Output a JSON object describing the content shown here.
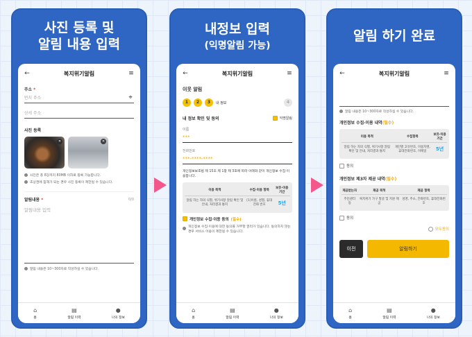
{
  "panel1": {
    "heading_line1": "사진 등록 및",
    "heading_line2": "알림 내용 입력",
    "app_title": "복지위기알림",
    "address_label": "주소",
    "address_placeholder": "번지 주소",
    "detail_placeholder": "상세 주소",
    "photo_label": "사진 등록",
    "photo_note1": "사진은 총 8장까지 80MB 이하로 등록 가능합니다.",
    "photo_note2": "초상권에 침해가 되는 경우 사진 등록이 제한될 수 있습니다.",
    "content_label": "알림내용",
    "content_counter": "0/0",
    "content_placeholder": "알림내용 입력",
    "content_note": "알림 내용은 10~300자로 작성하실 수 있습니다."
  },
  "panel2": {
    "heading_line1": "내정보 입력",
    "heading_line2": "(익명알림 가능)",
    "app_title": "복지위기알림",
    "section_title": "이웃 알림",
    "steps": [
      "1",
      "2",
      "3"
    ],
    "step_label": "내 정보",
    "step_next": "4",
    "info_title": "내 정보 확인 및 동의",
    "anon_label": "익명알림",
    "name_label": "이름",
    "name_value": "***",
    "phone_label": "전화번호",
    "phone_value": "***-****-****",
    "consent_text": "개인정보보호법 제 15조 제 1항 제 3호에 따라 아래와 같이 개인정보 수집·이용합니다.",
    "table_headers": [
      "이용 목적",
      "수집·이용 항목",
      "보유·이용 기간"
    ],
    "table_row": [
      "알림 하는 자의 식별, 위기사항 알림 확인 및 안내, 처리결과 통지",
      "[1]이름, 성별, 휴대전화 번호",
      "5년"
    ],
    "agree_label": "개인정보 수집·이용 동의",
    "agree_required": "(필수)",
    "agree_note": "개인정보 수집·이용에 대한 동의를 거부할 권리가 있습니다. 동의하지 않는 경우 서비스 이용이 제한될 수 있습니다."
  },
  "panel3": {
    "heading_line1": "알림 하기 완료",
    "app_title": "복지위기알림",
    "top_note": "알림 내용은 10~300자로 작성하실 수 있습니다.",
    "collect_title": "개인정보 수집·이용 내역",
    "required": "(필수)",
    "table1_headers": [
      "이용 목적",
      "수집항목",
      "보유·이용 기간"
    ],
    "table1_row": [
      "알림 하는 자의 식별, 위기사항 알림 확인 및 안내, 처리결과 통지",
      "개인별 고유번호, 이용자명, 휴대전화번호, 이메일",
      "5년"
    ],
    "agree1": "동의",
    "third_title": "개인정보 제3자 제공 내역",
    "table2_headers": [
      "제공받는자",
      "제공 목적",
      "제공 항목"
    ],
    "table2_row": [
      "주민센터 등",
      "복지위기 가구 발굴 및 지원 제공",
      "성명, 주소, 전화번호, 휴대전화번호"
    ],
    "agree2": "동의",
    "agree_all": "모두동의",
    "prev_button": "이전",
    "submit_button": "알림하기"
  },
  "nav": {
    "home": "홈",
    "history": "알림 이력",
    "myinfo": "나의 정보"
  },
  "colors": {
    "panel_blue": "#2f66c3",
    "accent_yellow": "#f5b800",
    "arrow_pink": "#f4578a"
  }
}
